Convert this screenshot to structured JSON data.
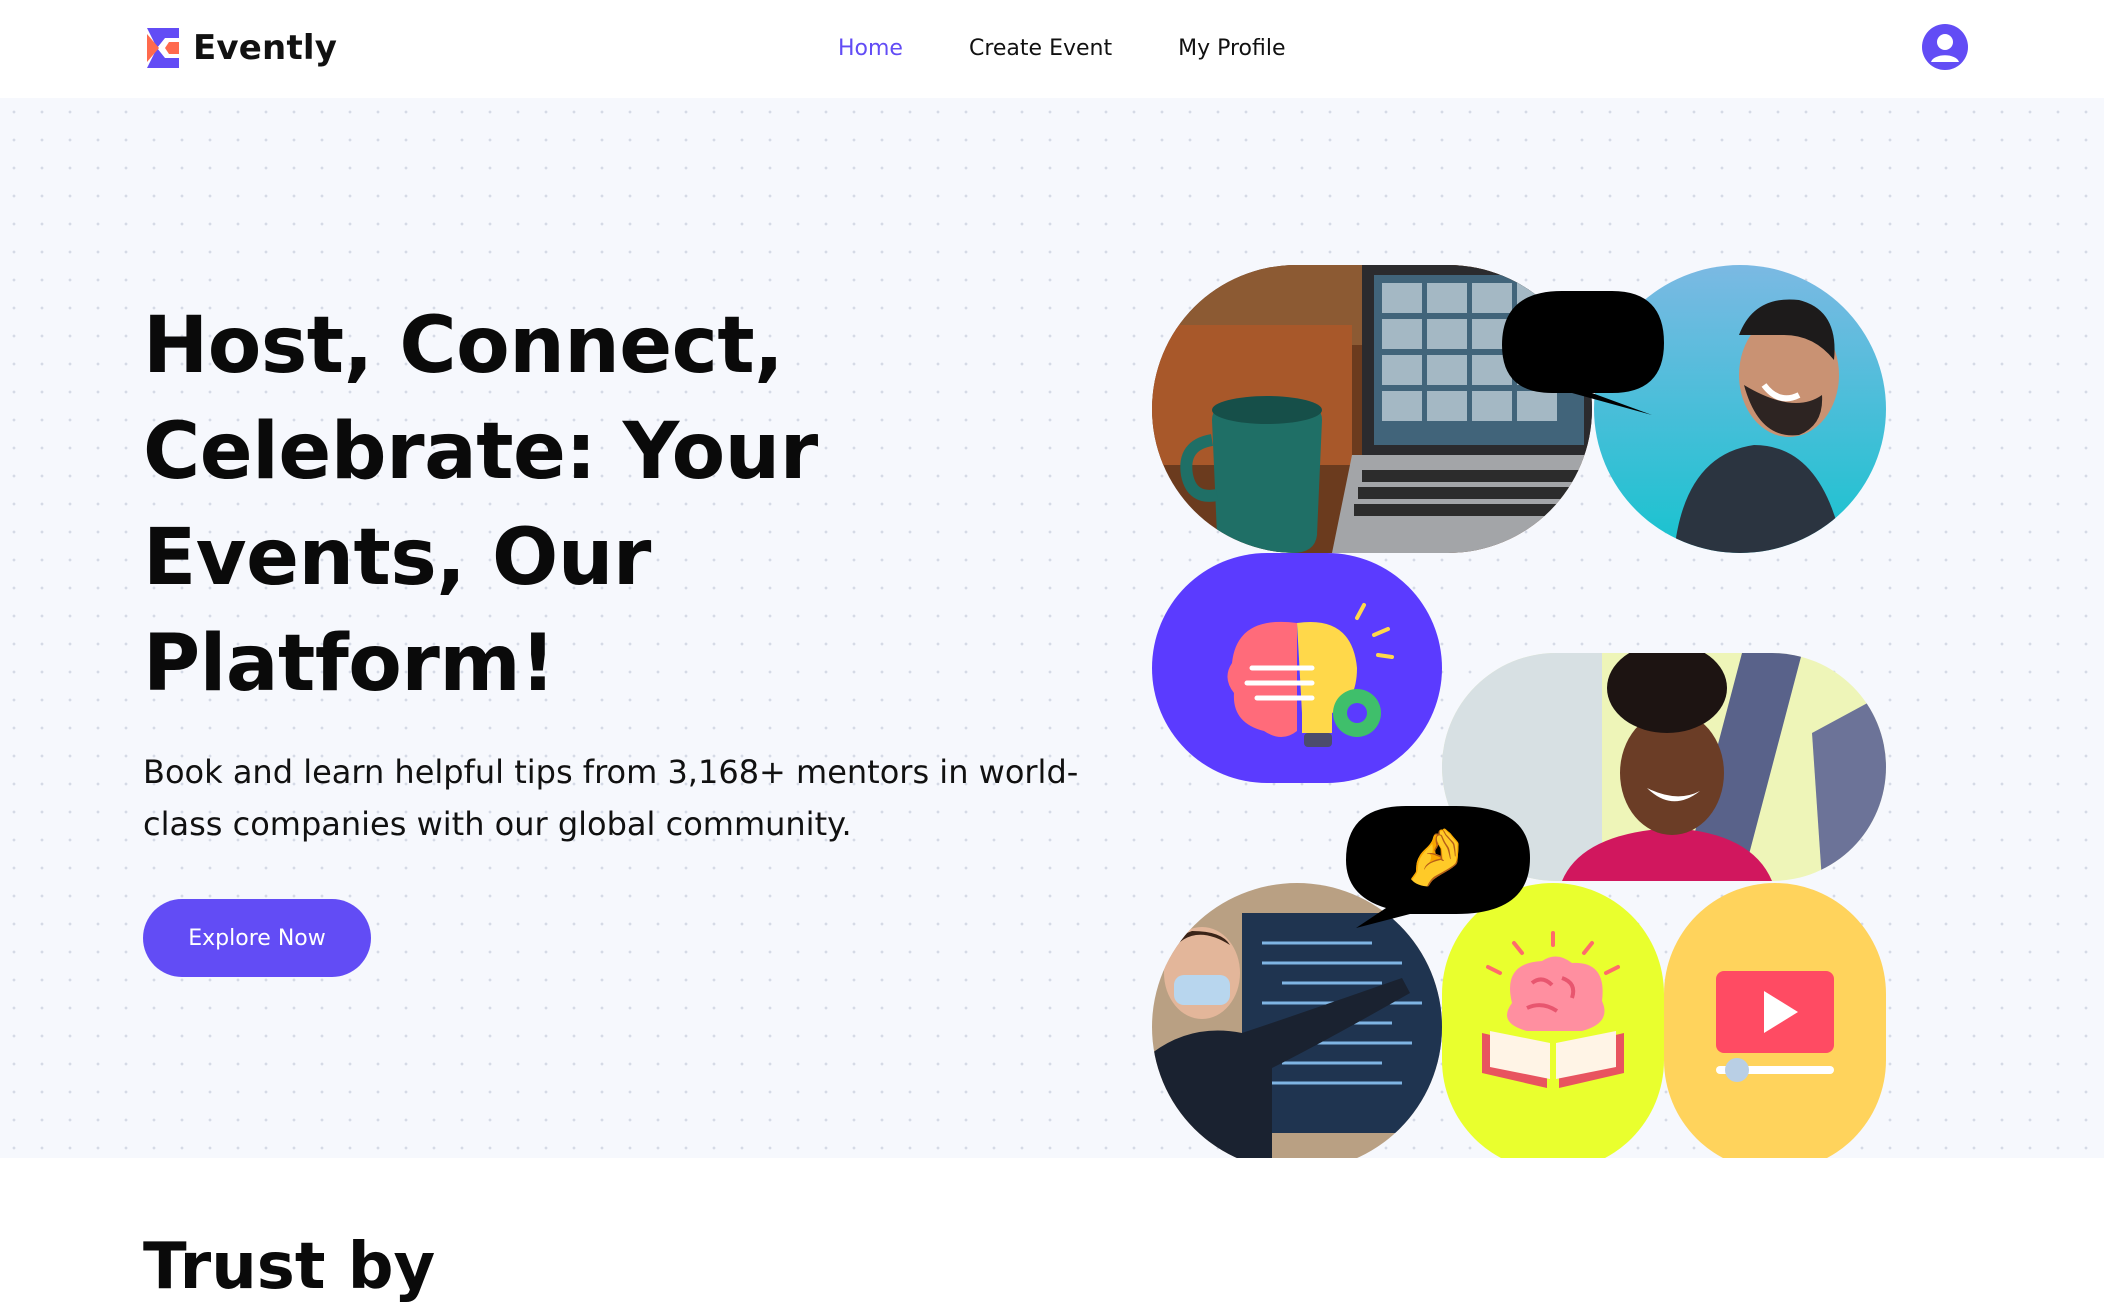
{
  "brand": {
    "name": "Evently"
  },
  "nav": {
    "items": [
      {
        "label": "Home",
        "active": true
      },
      {
        "label": "Create Event",
        "active": false
      },
      {
        "label": "My Profile",
        "active": false
      }
    ]
  },
  "hero": {
    "headline": "Host, Connect, Celebrate: Your Events, Our Platform!",
    "subtext": "Book and learn helpful tips from 3,168+ mentors in world-class companies with our global community.",
    "cta_label": "Explore Now"
  },
  "collage": {
    "tiles": [
      {
        "name": "video-call-laptop-photo",
        "kind": "photo"
      },
      {
        "name": "laughing-man-photo",
        "kind": "photo"
      },
      {
        "name": "brain-lightbulb-illustration",
        "kind": "illustration"
      },
      {
        "name": "smiling-woman-photo",
        "kind": "photo"
      },
      {
        "name": "presenter-photo",
        "kind": "photo"
      },
      {
        "name": "brain-book-illustration",
        "kind": "illustration"
      },
      {
        "name": "video-player-illustration",
        "kind": "illustration"
      }
    ],
    "bubbles": [
      {
        "emoji": "😍"
      },
      {
        "emoji": "🤌"
      }
    ]
  },
  "below": {
    "title": "Trust by"
  },
  "colors": {
    "accent": "#624cf5",
    "hero_bg": "#f6f8fd",
    "logo_orange": "#ff6a4d",
    "tile_purple": "#5b3bff",
    "tile_lime": "#e9ff2e",
    "tile_yellow": "#ffd35c"
  }
}
